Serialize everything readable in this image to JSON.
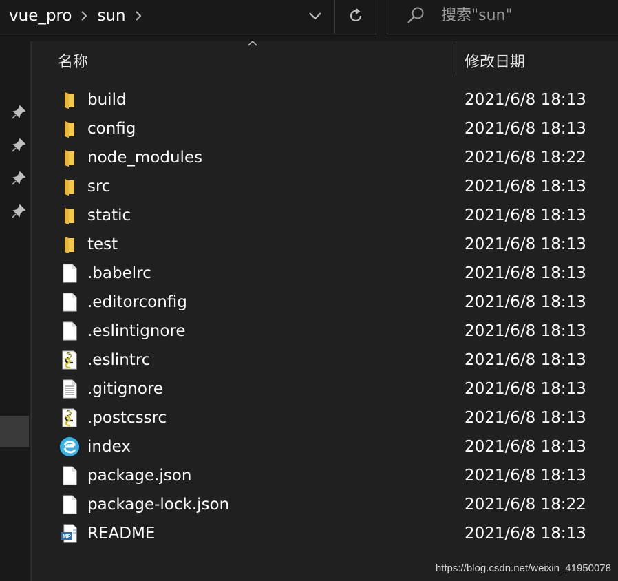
{
  "breadcrumbs": [
    "vue_pro",
    "sun"
  ],
  "search": {
    "placeholder": "搜索\"sun\""
  },
  "columns": {
    "name": "名称",
    "date_modified": "修改日期"
  },
  "files": [
    {
      "name": "build",
      "date": "2021/6/8 18:13",
      "icon": "folder-icon"
    },
    {
      "name": "config",
      "date": "2021/6/8 18:13",
      "icon": "folder-icon"
    },
    {
      "name": "node_modules",
      "date": "2021/6/8 18:22",
      "icon": "folder-icon"
    },
    {
      "name": "src",
      "date": "2021/6/8 18:13",
      "icon": "folder-icon"
    },
    {
      "name": "static",
      "date": "2021/6/8 18:13",
      "icon": "folder-icon"
    },
    {
      "name": "test",
      "date": "2021/6/8 18:13",
      "icon": "folder-icon"
    },
    {
      "name": ".babelrc",
      "date": "2021/6/8 18:13",
      "icon": "blank-file-icon"
    },
    {
      "name": ".editorconfig",
      "date": "2021/6/8 18:13",
      "icon": "blank-file-icon"
    },
    {
      "name": ".eslintignore",
      "date": "2021/6/8 18:13",
      "icon": "blank-file-icon"
    },
    {
      "name": ".eslintrc",
      "date": "2021/6/8 18:13",
      "icon": "script-file-icon"
    },
    {
      "name": ".gitignore",
      "date": "2021/6/8 18:13",
      "icon": "text-file-icon"
    },
    {
      "name": ".postcssrc",
      "date": "2021/6/8 18:13",
      "icon": "script-file-icon"
    },
    {
      "name": "index",
      "date": "2021/6/8 18:13",
      "icon": "browser-file-icon"
    },
    {
      "name": "package.json",
      "date": "2021/6/8 18:13",
      "icon": "blank-file-icon"
    },
    {
      "name": "package-lock.json",
      "date": "2021/6/8 18:22",
      "icon": "blank-file-icon"
    },
    {
      "name": "README",
      "date": "2021/6/8 18:13",
      "icon": "markdown-file-icon"
    }
  ],
  "watermark": "https://blog.csdn.net/weixin_41950078",
  "colors": {
    "folder": "#f3c94e",
    "accent": "#35b3e8",
    "background": "#202020"
  }
}
